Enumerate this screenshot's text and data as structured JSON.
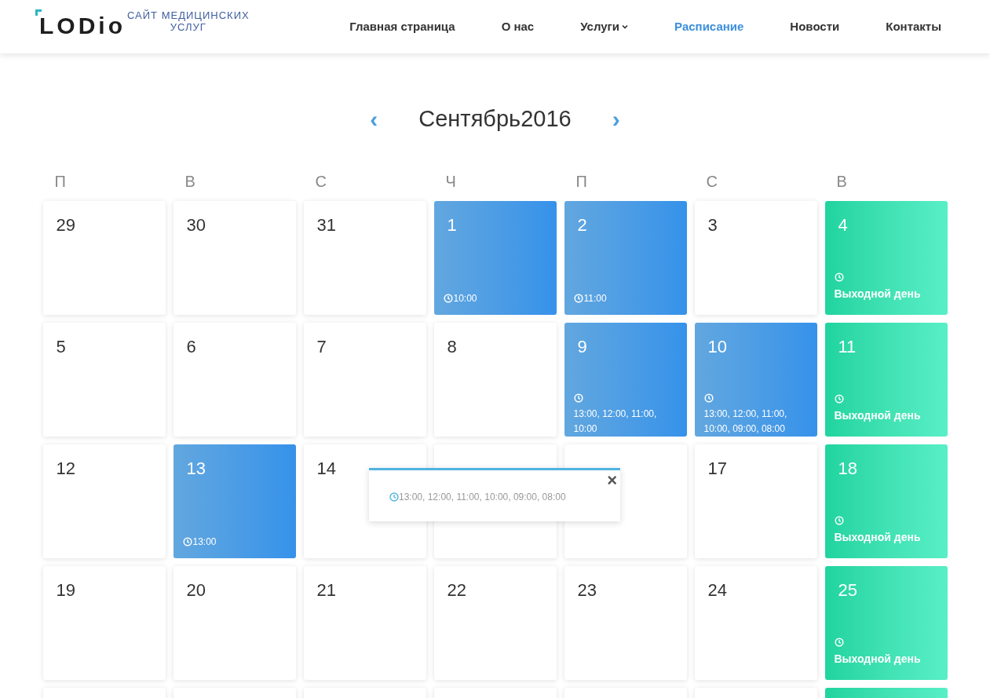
{
  "logo": {
    "mark": "LODio",
    "tagline_1": "САЙТ МЕДИЦИНСКИХ",
    "tagline_2": "УСЛУГ"
  },
  "nav": [
    {
      "label": "Главная страница",
      "selected": false,
      "has_dropdown": false
    },
    {
      "label": "О нас",
      "selected": false,
      "has_dropdown": false
    },
    {
      "label": "Услуги",
      "selected": false,
      "has_dropdown": true
    },
    {
      "label": "Расписание",
      "selected": true,
      "has_dropdown": false
    },
    {
      "label": "Новости",
      "selected": false,
      "has_dropdown": false
    },
    {
      "label": "Контакты",
      "selected": false,
      "has_dropdown": false
    }
  ],
  "calendar": {
    "month": "Сентябрь2016",
    "prev": "‹",
    "next": "›",
    "weekdays": [
      "П",
      "В",
      "С",
      "Ч",
      "П",
      "С",
      "В"
    ],
    "weeks": [
      [
        {
          "kind": "plain",
          "day": "29"
        },
        {
          "kind": "plain",
          "day": "30"
        },
        {
          "kind": "plain",
          "day": "31"
        },
        {
          "kind": "appointment",
          "day": "1",
          "times": "10:00"
        },
        {
          "kind": "appointment",
          "day": "2",
          "times": "11:00"
        },
        {
          "kind": "plain",
          "day": "3"
        },
        {
          "kind": "day_off",
          "day": "4",
          "times": "Выходной день"
        }
      ],
      [
        {
          "kind": "plain",
          "day": "5"
        },
        {
          "kind": "plain",
          "day": "6"
        },
        {
          "kind": "plain",
          "day": "7"
        },
        {
          "kind": "plain",
          "day": "8"
        },
        {
          "kind": "appointments",
          "day": "9",
          "times": "13:00, 12:00, 11:00, 10:00"
        },
        {
          "kind": "appointments",
          "day": "10",
          "times": "13:00, 12:00, 11:00, 10:00, 09:00, 08:00"
        },
        {
          "kind": "day_off",
          "day": "11",
          "times": "Выходной день"
        }
      ],
      [
        {
          "kind": "plain",
          "day": "12"
        },
        {
          "kind": "appointment",
          "day": "13",
          "times": "13:00"
        },
        {
          "kind": "plain",
          "day": "14"
        },
        {
          "kind": "plain"
        },
        {
          "kind": "plain"
        },
        {
          "kind": "plain",
          "day": "17"
        },
        {
          "kind": "day_off",
          "day": "18",
          "times": "Выходной день"
        }
      ],
      [
        {
          "kind": "plain",
          "day": "19"
        },
        {
          "kind": "plain",
          "day": "20"
        },
        {
          "kind": "plain",
          "day": "21"
        },
        {
          "kind": "plain",
          "day": "22"
        },
        {
          "kind": "plain",
          "day": "23"
        },
        {
          "kind": "plain",
          "day": "24"
        },
        {
          "kind": "day_off",
          "day": "25",
          "times": "Выходной день"
        }
      ],
      [
        {
          "kind": "plain"
        },
        {
          "kind": "plain"
        },
        {
          "kind": "plain"
        },
        {
          "kind": "plain"
        },
        {
          "kind": "plain"
        },
        {
          "kind": "plain"
        },
        {
          "kind": "day_off"
        }
      ]
    ]
  },
  "popover": {
    "times": "13:00, 12:00, 11:00, 10:00, 09:00, 08:00",
    "close": "×"
  }
}
